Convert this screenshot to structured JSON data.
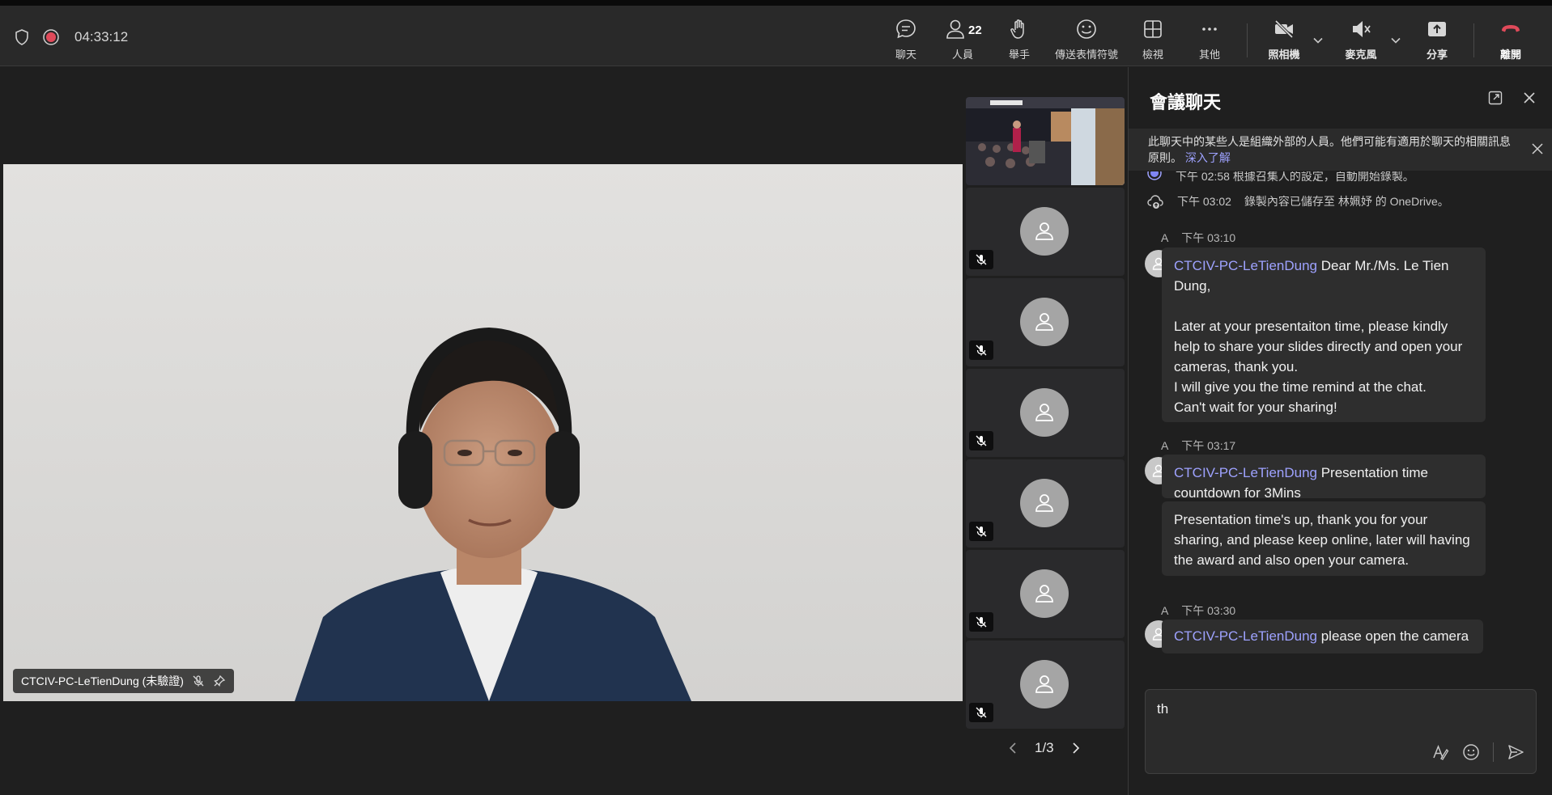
{
  "toolbar": {
    "timer": "04:33:12",
    "chat_label": "聊天",
    "people_label": "人員",
    "people_count": "22",
    "raise_hand_label": "舉手",
    "reactions_label": "傳送表情符號",
    "view_label": "檢視",
    "more_label": "其他",
    "camera_label": "照相機",
    "mic_label": "麥克風",
    "share_label": "分享",
    "leave_label": "離開",
    "accent_color": "#7f85f5",
    "leave_color": "#e04a5a"
  },
  "stage": {
    "speaker_name": "CTCIV-PC-LeTienDung (未驗證)",
    "pager": "1/3"
  },
  "chat": {
    "title": "會議聊天",
    "banner_text": "此聊天中的某些人是組織外部的人員。他們可能有適用於聊天的相關訊息原則。",
    "banner_link": "深入了解",
    "system1": "下午 02:58   根據召集人的設定，自動開始錄製。",
    "system2_time": "下午 03:02",
    "system2_text": "錄製內容已儲存至 林姵妤 的 OneDrive。",
    "messages": [
      {
        "initial": "A",
        "time": "下午 03:10",
        "sender": "CTCIV-PC-LeTienDung",
        "text": " Dear Mr./Ms. Le Tien Dung,",
        "body": "Later at your presentaiton time, please kindly help to share your slides directly and open your cameras, thank you.",
        "body2": "I will give you the time remind at the chat.",
        "body3": "Can't wait for your sharing!"
      },
      {
        "initial": "A",
        "time": "下午 03:17",
        "sender": "CTCIV-PC-LeTienDung",
        "text": " Presentation time countdown for 3Mins",
        "body": "Presentation time's up, thank you for your sharing, and please keep online, later will having the award and also open your camera."
      },
      {
        "initial": "A",
        "time": "下午 03:30",
        "sender": "CTCIV-PC-LeTienDung",
        "text": " please open the camera"
      }
    ],
    "compose_value": "th"
  }
}
